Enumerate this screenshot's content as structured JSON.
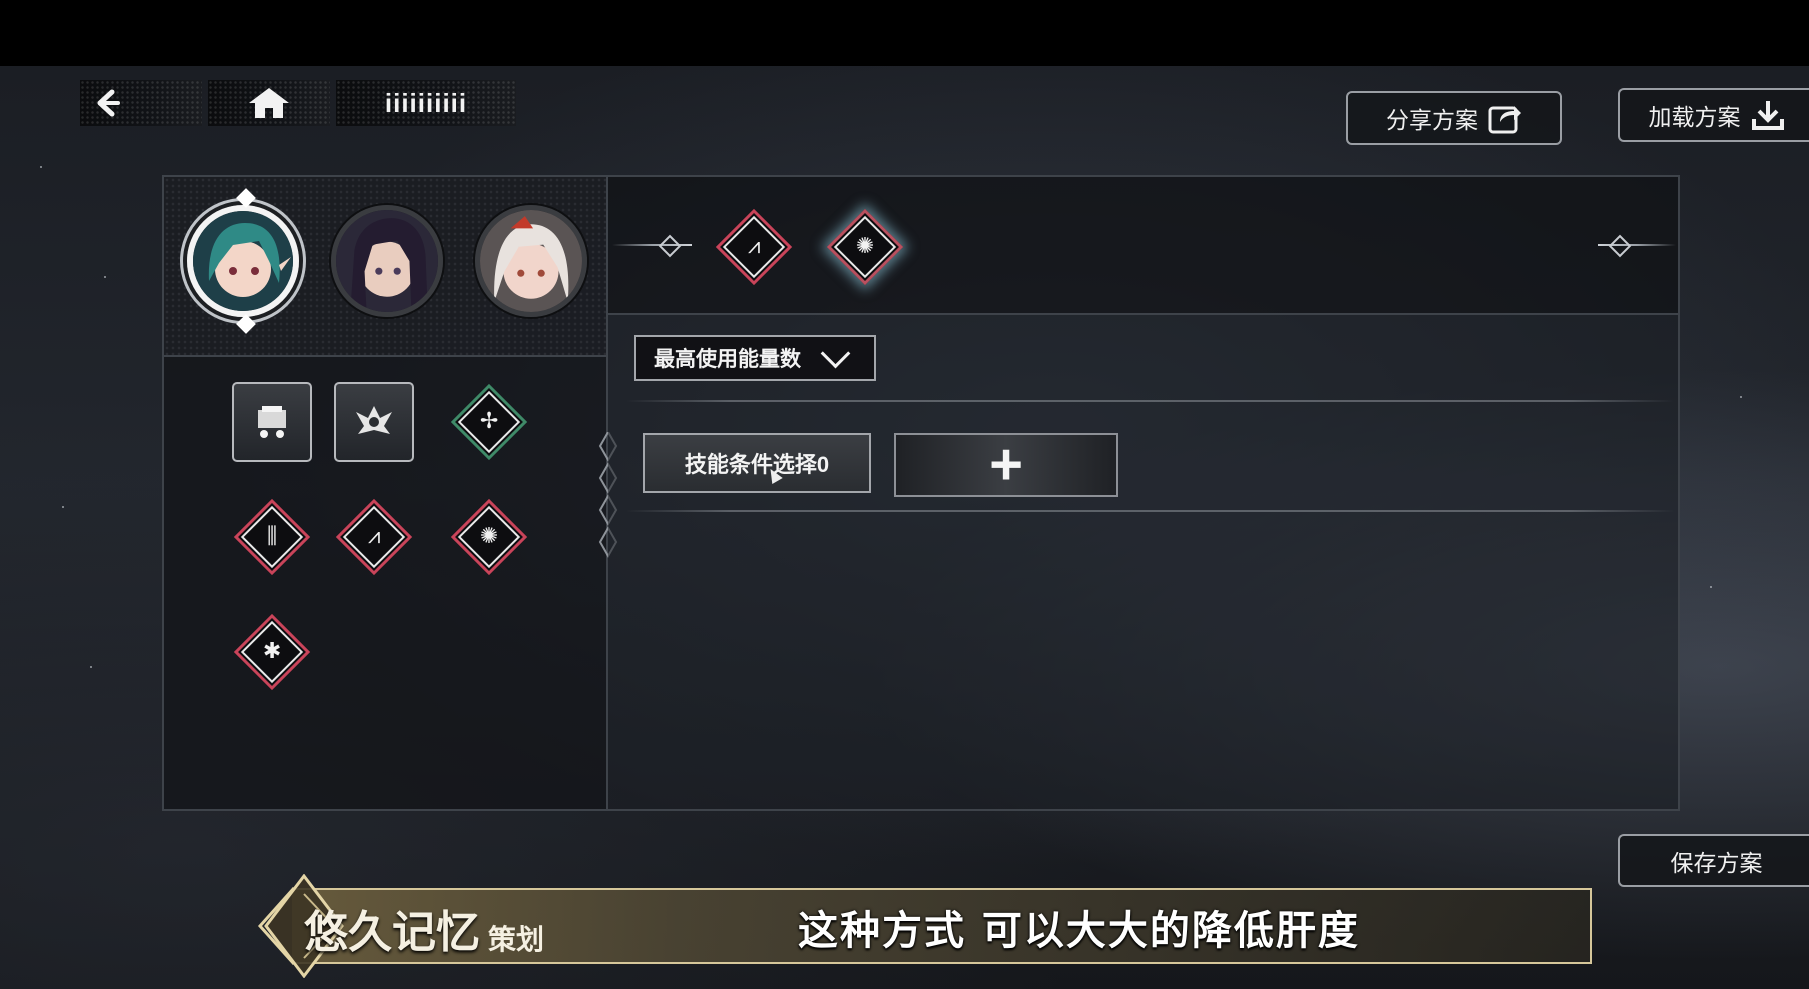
{
  "nav": {
    "back_icon": "back-arrow-icon",
    "home_icon": "home-icon",
    "title": "iiiiiiiiii"
  },
  "actions": {
    "share_label": "分享方案",
    "share_icon": "share-icon",
    "load_label": "加载方案",
    "load_icon": "download-icon",
    "save_label": "保存方案"
  },
  "characters": [
    {
      "name": "character-1",
      "selected": true,
      "hair": "#2f8a86",
      "skin": "#f3d6c8"
    },
    {
      "name": "character-2",
      "selected": false,
      "hair": "#241c30",
      "skin": "#e9cdbf"
    },
    {
      "name": "character-3",
      "selected": false,
      "hair": "#e8e2de",
      "skin": "#f1d5cb"
    }
  ],
  "skills": [
    {
      "kind": "square",
      "icon": "item-box-icon",
      "glyph": "▦"
    },
    {
      "kind": "square",
      "icon": "wing-crest-icon",
      "glyph": "♆"
    },
    {
      "kind": "diamond-green",
      "icon": "burst-heal-icon",
      "glyph": "✢"
    },
    {
      "kind": "diamond-red",
      "icon": "rain-strike-icon",
      "glyph": "⫼"
    },
    {
      "kind": "diamond-red",
      "icon": "slash-combo-icon",
      "glyph": "⩘"
    },
    {
      "kind": "diamond-red",
      "icon": "radiant-summon-icon",
      "glyph": "✺"
    },
    {
      "kind": "diamond-red",
      "icon": "beetle-icon",
      "glyph": "✱"
    }
  ],
  "selected_skills": [
    {
      "icon": "slash-combo-icon",
      "glyph": "⩘",
      "highlight": false
    },
    {
      "icon": "radiant-summon-icon",
      "glyph": "✺",
      "highlight": true
    }
  ],
  "dropdown": {
    "value": "最高使用能量数"
  },
  "condition": {
    "label": "技能条件选择0",
    "add_symbol": "+"
  },
  "subtitle": {
    "speaker": "悠久记忆",
    "role": "策划",
    "text": "这种方式 可以大大的降低肝度"
  }
}
